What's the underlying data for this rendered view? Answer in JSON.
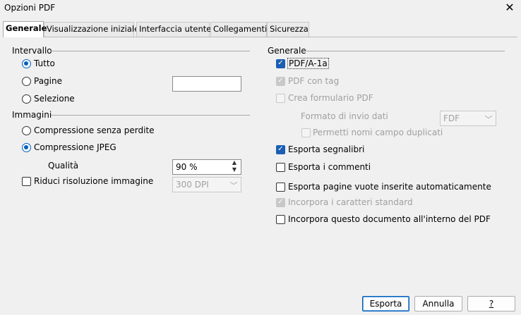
{
  "window": {
    "title": "Opzioni PDF"
  },
  "tabs": [
    {
      "label": "Generale"
    },
    {
      "label": "Visualizzazione iniziale"
    },
    {
      "label": "Interfaccia utente"
    },
    {
      "label": "Collegamenti"
    },
    {
      "label": "Sicurezza"
    }
  ],
  "left": {
    "range": {
      "title": "Intervallo",
      "all": "Tutto",
      "pages": "Pagine",
      "pages_value": "",
      "selection": "Selezione"
    },
    "images": {
      "title": "Immagini",
      "lossless": "Compressione senza perdite",
      "jpeg": "Compressione JPEG",
      "quality_label": "Qualità",
      "quality_value": "90 %",
      "reduce": "Riduci risoluzione immagine",
      "dpi_value": "300 DPI"
    }
  },
  "right": {
    "title": "Generale",
    "pdfa": "PDF/A-1a",
    "tagged": "PDF con tag",
    "form": "Crea formulario PDF",
    "submit_format_label": "Formato di invio dati",
    "submit_format_value": "FDF",
    "allow_dup": "Permetti nomi campo duplicati",
    "bookmarks": "Esporta segnalibri",
    "comments": "Esporta i commenti",
    "blank_pages": "Esporta pagine vuote inserite automaticamente",
    "std_fonts": "Incorpora i caratteri standard",
    "embed_doc": "Incorpora questo documento all'interno del PDF"
  },
  "buttons": {
    "export": "Esporta",
    "cancel": "Annulla",
    "help": "?"
  }
}
